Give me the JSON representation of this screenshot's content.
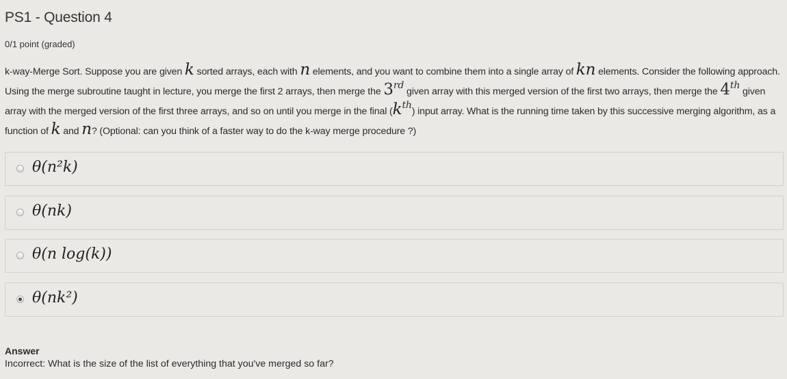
{
  "header": {
    "title": "PS1 - Question 4",
    "points": "0/1 point (graded)"
  },
  "problem": {
    "p1": "k-way-Merge Sort. Suppose you are given ",
    "k": "k",
    "p2": " sorted arrays, each with ",
    "n": "n",
    "p3": " elements, and you want to combine them into a single array of ",
    "kn": "kn",
    "p4": " elements. Consider the following approach. Using the merge subroutine taught in lecture, you merge the first 2 arrays, then merge the ",
    "third_base": "3",
    "third_sup": "rd",
    "p5": " given array with this merged version of the first two arrays, then merge the ",
    "fourth_base": "4",
    "fourth_sup": "th",
    "p6": " given array with the merged version of the first three arrays, and so on until you merge in the final (",
    "kth_base": "k",
    "kth_sup": "th",
    "p7": ") input array. What is the running time taken by this successive merging algorithm, as a function of ",
    "k2": "k",
    "p8": " and ",
    "n2": "n",
    "p9": "? (Optional: can you think of a faster way to do the k-way merge procedure ?)"
  },
  "options": [
    {
      "label": "θ(n²k)",
      "selected": false
    },
    {
      "label": "θ(nk)",
      "selected": false
    },
    {
      "label": "θ(n log(k))",
      "selected": false
    },
    {
      "label": "θ(nk²)",
      "selected": true
    }
  ],
  "answer": {
    "heading": "Answer",
    "text": "Incorrect:  What is the size of the list of everything that you've merged so far?"
  }
}
